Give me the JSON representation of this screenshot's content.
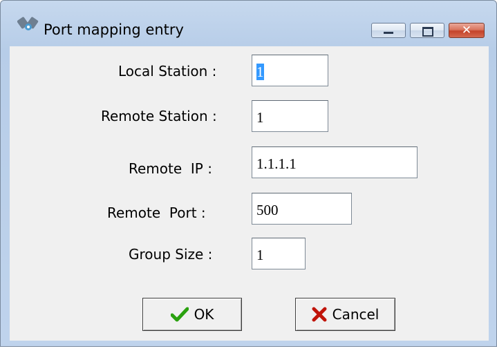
{
  "window": {
    "title": "Port mapping entry",
    "icon": "network-ports-icon",
    "close_glyph": "✕"
  },
  "form": {
    "local_station": {
      "label": "Local Station :",
      "value": "1"
    },
    "remote_station": {
      "label": "Remote Station :",
      "value": "1"
    },
    "remote_ip": {
      "label": "Remote  IP :",
      "value": "1.1.1.1"
    },
    "remote_port": {
      "label": "Remote  Port :",
      "value": "500"
    },
    "group_size": {
      "label": "Group Size :",
      "value": "1"
    }
  },
  "buttons": {
    "ok_label": "OK",
    "cancel_label": "Cancel"
  },
  "colors": {
    "titlebar": "#bfd3ec",
    "selection": "#3399ff",
    "ok_check": "#2aa10f",
    "cancel_x": "#c0140a"
  }
}
